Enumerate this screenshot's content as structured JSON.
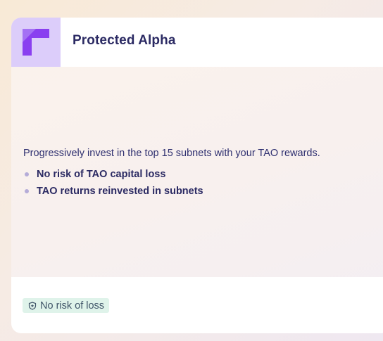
{
  "card": {
    "title": "Protected Alpha",
    "logo_icon": "brand-logo-icon",
    "description": "Progressively invest in the top 15 subnets with your TAO rewards.",
    "features": [
      "No risk of TAO capital loss",
      "TAO returns reinvested in subnets"
    ],
    "badge": {
      "icon": "shield-icon",
      "label": "No risk of loss"
    }
  },
  "colors": {
    "title": "#2b2a63",
    "logo_bg": "#dccdfa",
    "logo_mark": "#8a3ff0",
    "badge_bg": "#dff3ea"
  }
}
